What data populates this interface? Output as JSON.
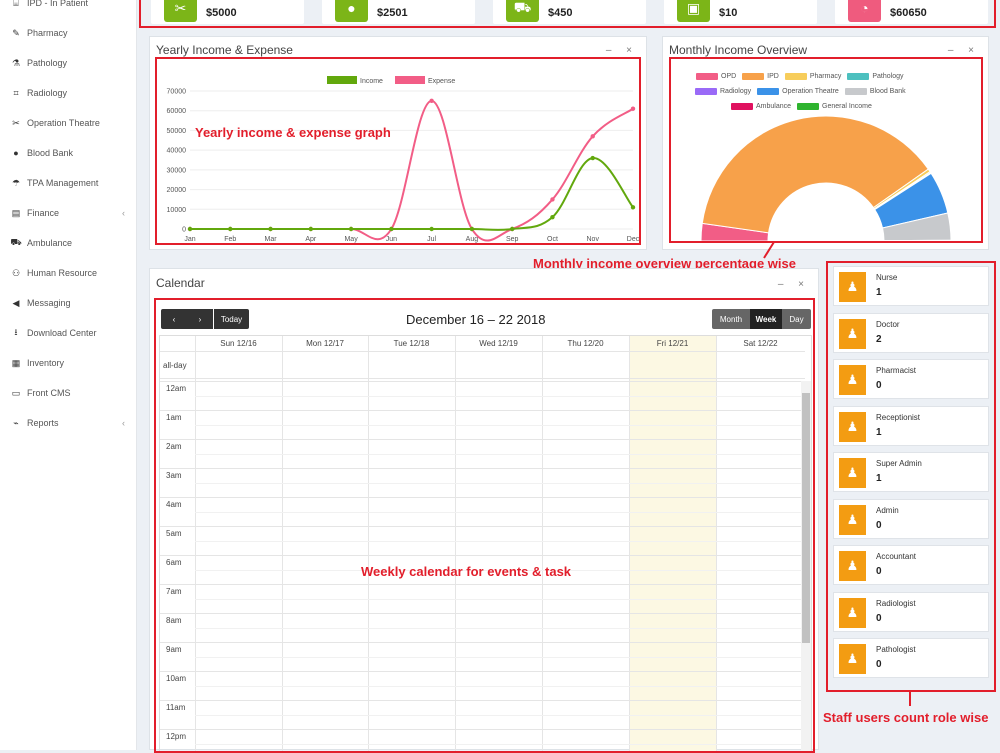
{
  "sidebar": {
    "items": [
      {
        "icon": "bed-icon",
        "glyph": "⌸",
        "label": "IPD - In Patient",
        "chevron": ""
      },
      {
        "icon": "mortar-icon",
        "glyph": "✎",
        "label": "Pharmacy",
        "chevron": ""
      },
      {
        "icon": "flask-icon",
        "glyph": "⚗",
        "label": "Pathology",
        "chevron": ""
      },
      {
        "icon": "microscope-icon",
        "glyph": "⌗",
        "label": "Radiology",
        "chevron": ""
      },
      {
        "icon": "scissors-icon",
        "glyph": "✂",
        "label": "Operation Theatre",
        "chevron": ""
      },
      {
        "icon": "drop-icon",
        "glyph": "●",
        "label": "Blood Bank",
        "chevron": ""
      },
      {
        "icon": "umbrella-icon",
        "glyph": "☂",
        "label": "TPA Management",
        "chevron": ""
      },
      {
        "icon": "money-icon",
        "glyph": "▤",
        "label": "Finance",
        "chevron": "‹"
      },
      {
        "icon": "ambulance-icon",
        "glyph": "⛟",
        "label": "Ambulance",
        "chevron": ""
      },
      {
        "icon": "sitemap-icon",
        "glyph": "⚇",
        "label": "Human Resource",
        "chevron": ""
      },
      {
        "icon": "bullhorn-icon",
        "glyph": "◀",
        "label": "Messaging",
        "chevron": ""
      },
      {
        "icon": "download-icon",
        "glyph": "⭳",
        "label": "Download Center",
        "chevron": ""
      },
      {
        "icon": "boxes-icon",
        "glyph": "▦",
        "label": "Inventory",
        "chevron": ""
      },
      {
        "icon": "monitor-icon",
        "glyph": "▭",
        "label": "Front CMS",
        "chevron": ""
      },
      {
        "icon": "chart-icon",
        "glyph": "⌁",
        "label": "Reports",
        "chevron": "‹"
      }
    ]
  },
  "cards": [
    {
      "icon": "scissors-icon",
      "glyph": "✂",
      "color": "#7cb518",
      "value": "$5000"
    },
    {
      "icon": "drop-icon",
      "glyph": "●",
      "color": "#7cb518",
      "value": "$2501"
    },
    {
      "icon": "ambulance-icon",
      "glyph": "⛟",
      "color": "#7cb518",
      "value": "$450"
    },
    {
      "icon": "money-icon",
      "glyph": "▣",
      "color": "#7cb518",
      "value": "$10"
    },
    {
      "icon": "expense-icon",
      "glyph": "◔",
      "color": "#ef5b7e",
      "value": "$60650"
    }
  ],
  "yearly": {
    "title": "Yearly Income & Expense",
    "tools": "– ×",
    "annotation": "Yearly income & expense graph"
  },
  "monthly": {
    "title": "Monthly Income Overview",
    "tools": "– ×",
    "annotation": "Monthly income overview percentage wise"
  },
  "chart_data": [
    {
      "type": "line",
      "categories": [
        "Jan",
        "Feb",
        "Mar",
        "Apr",
        "May",
        "Jun",
        "Jul",
        "Aug",
        "Sep",
        "Oct",
        "Nov",
        "Dec"
      ],
      "series": [
        {
          "name": "Income",
          "color": "#62a80d",
          "values": [
            0,
            0,
            0,
            0,
            0,
            0,
            0,
            0,
            0,
            6000,
            36000,
            11000
          ]
        },
        {
          "name": "Expense",
          "color": "#f25d86",
          "values": [
            0,
            0,
            0,
            0,
            0,
            0,
            65000,
            0,
            0,
            15000,
            47000,
            61000
          ]
        }
      ],
      "yticks": [
        0,
        10000,
        20000,
        30000,
        40000,
        50000,
        60000,
        70000
      ],
      "ylim": [
        0,
        70000
      ],
      "legend_position": "top"
    },
    {
      "type": "pie",
      "style": "half-doughnut",
      "legend_position": "top",
      "legend": [
        {
          "name": "OPD",
          "color": "#f25d86"
        },
        {
          "name": "IPD",
          "color": "#f7a14a"
        },
        {
          "name": "Pharmacy",
          "color": "#f7cd5b"
        },
        {
          "name": "Pathology",
          "color": "#4dc0bf"
        },
        {
          "name": "Radiology",
          "color": "#9a6af7"
        },
        {
          "name": "Operation Theatre",
          "color": "#3b92e8"
        },
        {
          "name": "Blood Bank",
          "color": "#c7c9cc"
        },
        {
          "name": "Ambulance",
          "color": "#e0115f"
        },
        {
          "name": "General Income",
          "color": "#2fb42f"
        }
      ],
      "values": [
        {
          "name": "OPD",
          "value": 4.5,
          "color": "#f25d86"
        },
        {
          "name": "IPD",
          "value": 76,
          "color": "#f7a14a"
        },
        {
          "name": "Pharmacy",
          "value": 0.8,
          "color": "#f7cd5b"
        },
        {
          "name": "Pathology",
          "value": 0.3,
          "color": "#4dc0bf"
        },
        {
          "name": "Radiology",
          "value": 0.2,
          "color": "#9a6af7"
        },
        {
          "name": "Operation Theatre",
          "value": 11,
          "color": "#3b92e8"
        },
        {
          "name": "Blood Bank",
          "value": 7,
          "color": "#c7c9cc"
        },
        {
          "name": "Ambulance",
          "value": 0.1,
          "color": "#e0115f"
        },
        {
          "name": "General Income",
          "value": 0.1,
          "color": "#2fb42f"
        }
      ]
    }
  ],
  "calendar": {
    "title": "Calendar",
    "tools": "– ×",
    "prev": "‹",
    "next": "›",
    "today": "Today",
    "range": "December 16 – 22 2018",
    "views": [
      "Month",
      "Week",
      "Day"
    ],
    "days": [
      "Sun 12/16",
      "Mon 12/17",
      "Tue 12/18",
      "Wed 12/19",
      "Thu 12/20",
      "Fri 12/21",
      "Sat 12/22"
    ],
    "allday": "all-day",
    "times": [
      "12am",
      "1am",
      "2am",
      "3am",
      "4am",
      "5am",
      "6am",
      "7am",
      "8am",
      "9am",
      "10am",
      "11am",
      "12pm"
    ],
    "annotation": "Weekly calendar for events & task"
  },
  "staff": {
    "annotation": "Staff users count role wise",
    "items": [
      {
        "role": "Nurse",
        "count": "1"
      },
      {
        "role": "Doctor",
        "count": "2"
      },
      {
        "role": "Pharmacist",
        "count": "0"
      },
      {
        "role": "Receptionist",
        "count": "1"
      },
      {
        "role": "Super Admin",
        "count": "1"
      },
      {
        "role": "Admin",
        "count": "0"
      },
      {
        "role": "Accountant",
        "count": "0"
      },
      {
        "role": "Radiologist",
        "count": "0"
      },
      {
        "role": "Pathologist",
        "count": "0"
      }
    ]
  }
}
